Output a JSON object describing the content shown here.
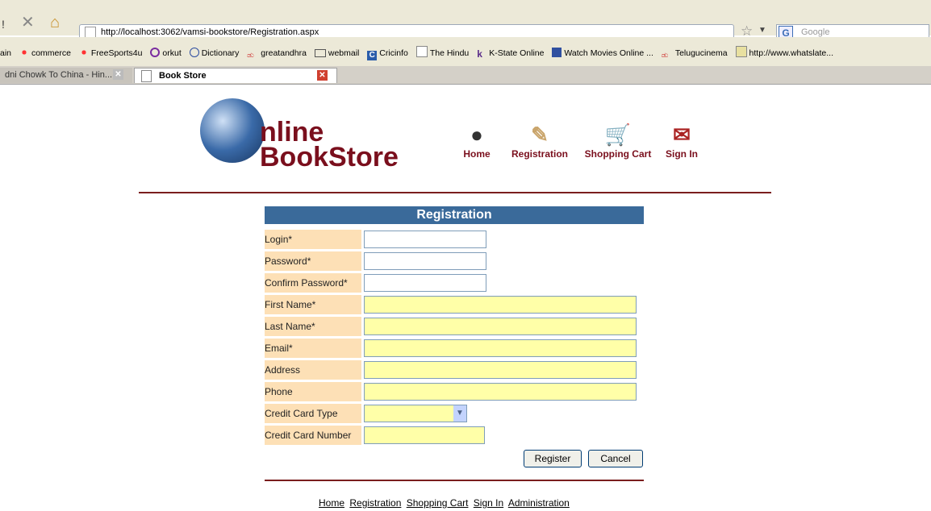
{
  "browser": {
    "url": "http://localhost:3062/vamsi-bookstore/Registration.aspx",
    "search_placeholder": "Google",
    "bookmarks": [
      "ain",
      "commerce",
      "FreeSports4u",
      "orkut",
      "Dictionary",
      "greatandhra",
      "webmail",
      "Cricinfo",
      "The Hindu",
      "K-State Online",
      "Watch Movies Online ...",
      "Telugucinema",
      "http://www.whatslate..."
    ],
    "tabs": [
      {
        "label": "dni Chowk To China - Hin..."
      },
      {
        "label": "Book Store"
      }
    ]
  },
  "site": {
    "logo_line1": "nline",
    "logo_line2": "BookStore",
    "nav": [
      {
        "label": "Home",
        "icon": "globe-icon"
      },
      {
        "label": "Registration",
        "icon": "pen-paper-icon"
      },
      {
        "label": "Shopping Cart",
        "icon": "cart-icon"
      },
      {
        "label": "Sign In",
        "icon": "signin-icon"
      }
    ]
  },
  "form": {
    "title": "Registration",
    "fields": {
      "login": "Login*",
      "password": "Password*",
      "confirm_password": "Confirm Password*",
      "first_name": "First Name*",
      "last_name": "Last Name*",
      "email": "Email*",
      "address": "Address",
      "phone": "Phone",
      "credit_card_type": "Credit Card Type",
      "credit_card_number": "Credit Card Number"
    },
    "register_label": "Register",
    "cancel_label": "Cancel"
  },
  "footer_links": [
    "Home",
    "Registration",
    "Shopping Cart",
    "Sign In",
    "Administration"
  ],
  "colors": {
    "brand": "#7a0f1d",
    "header_bar": "#3a6a9a",
    "label_bg": "#fde0b6",
    "required_input_bg": "#ffffa8"
  }
}
